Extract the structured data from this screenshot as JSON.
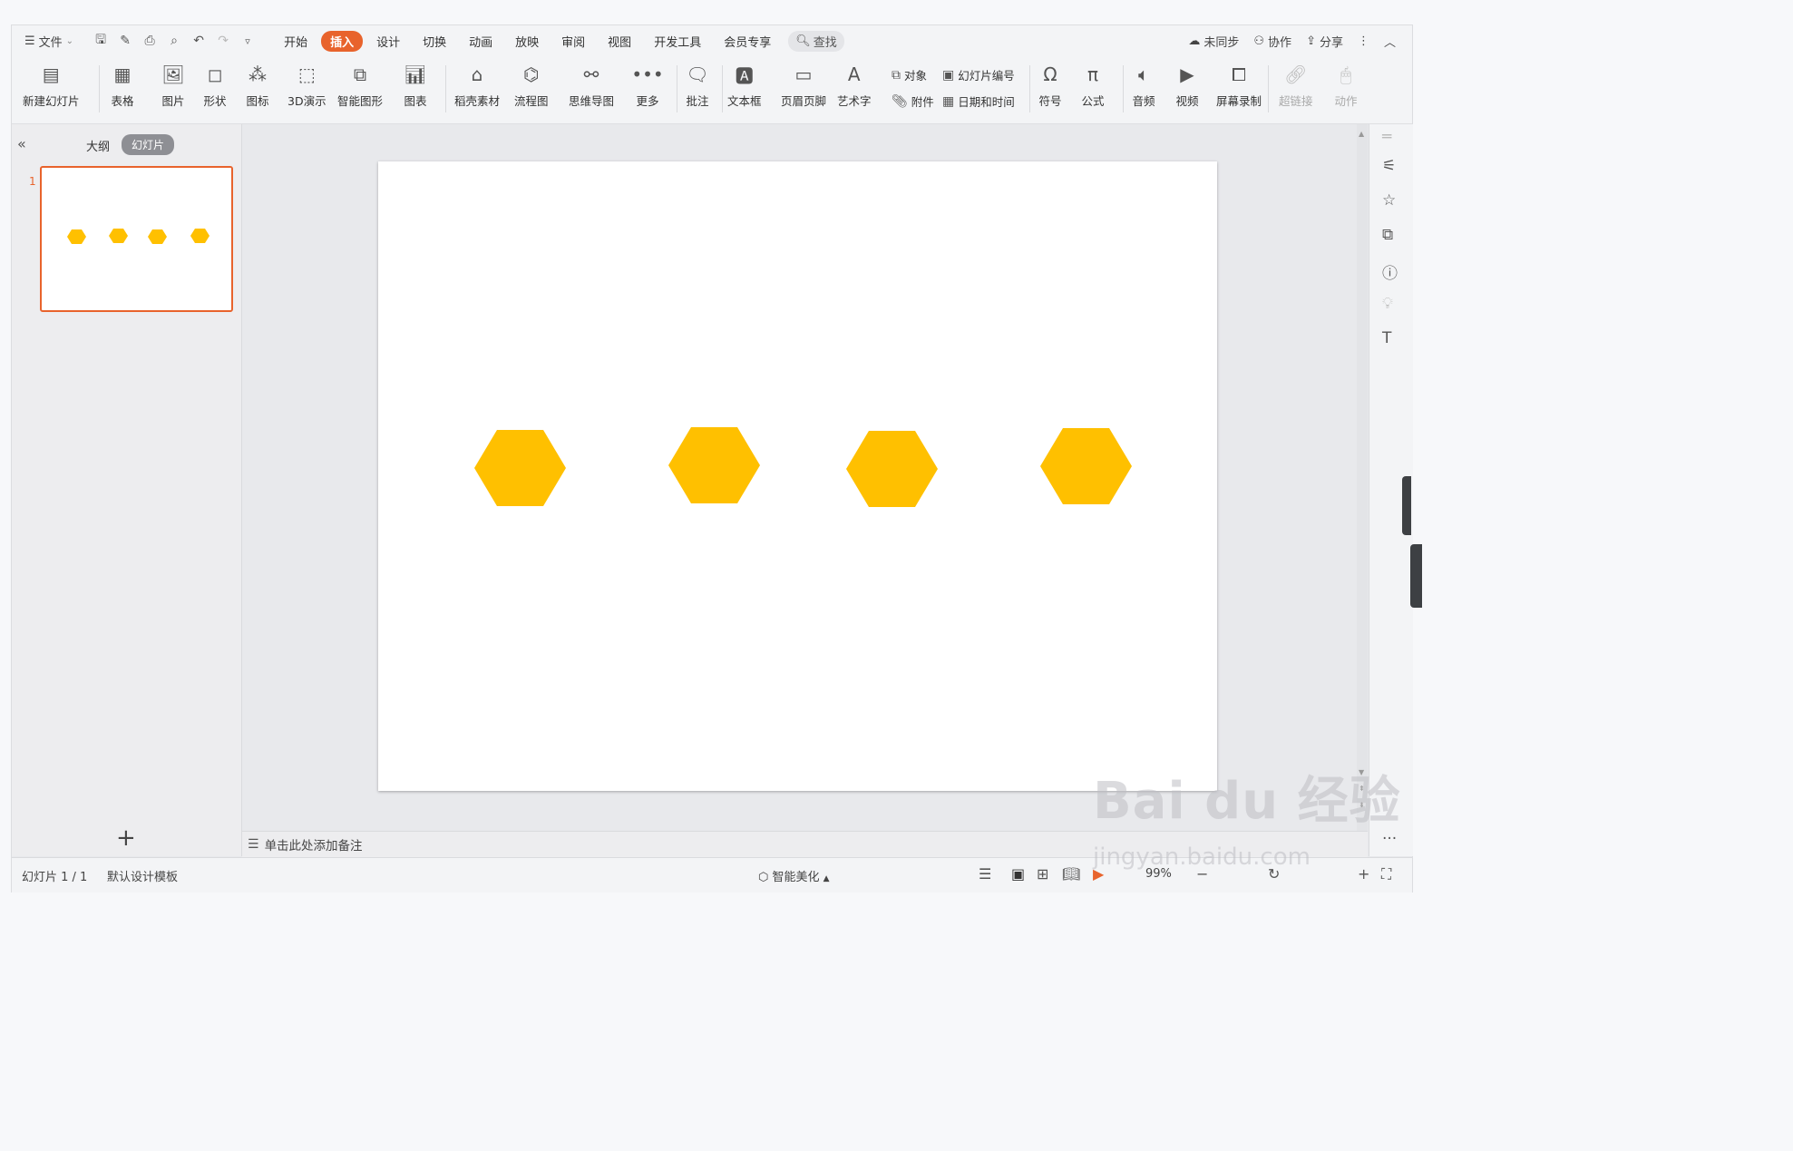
{
  "menubar": {
    "file_label": "文件",
    "tabs": [
      "开始",
      "插入",
      "设计",
      "切换",
      "动画",
      "放映",
      "审阅",
      "视图",
      "开发工具",
      "会员专享"
    ],
    "active_tab": "插入",
    "search_label": "查找",
    "sync_label": "未同步",
    "collab_label": "协作",
    "share_label": "分享"
  },
  "ribbon": {
    "new_slide": "新建幻灯片",
    "table": "表格",
    "picture": "图片",
    "shape": "形状",
    "icon": "图标",
    "demo3d": "3D演示",
    "smartart": "智能图形",
    "chart": "图表",
    "material": "稻壳素材",
    "flowchart": "流程图",
    "mindmap": "思维导图",
    "more": "更多",
    "comment": "批注",
    "textbox": "文本框",
    "header_footer": "页眉页脚",
    "wordart": "艺术字",
    "object": "对象",
    "slide_number": "幻灯片编号",
    "attachment": "附件",
    "datetime": "日期和时间",
    "symbol": "符号",
    "formula": "公式",
    "audio": "音频",
    "video": "视频",
    "screen_record": "屏幕录制",
    "hyperlink": "超链接",
    "action": "动作"
  },
  "left_panel": {
    "outline_label": "大纲",
    "slides_label": "幻灯片",
    "slide_number": "1"
  },
  "slide": {
    "shape_color": "#ffc000",
    "shape_count": 4
  },
  "notes": {
    "placeholder": "单击此处添加备注"
  },
  "status": {
    "slide_indicator": "幻灯片 1 / 1",
    "template": "默认设计模板",
    "beautify": "智能美化",
    "zoom": "99%"
  },
  "colors": {
    "accent": "#e8632c",
    "hexagon": "#ffc000"
  },
  "watermark": {
    "text": "Bai du 经验",
    "url": "jingyan.baidu.com"
  }
}
